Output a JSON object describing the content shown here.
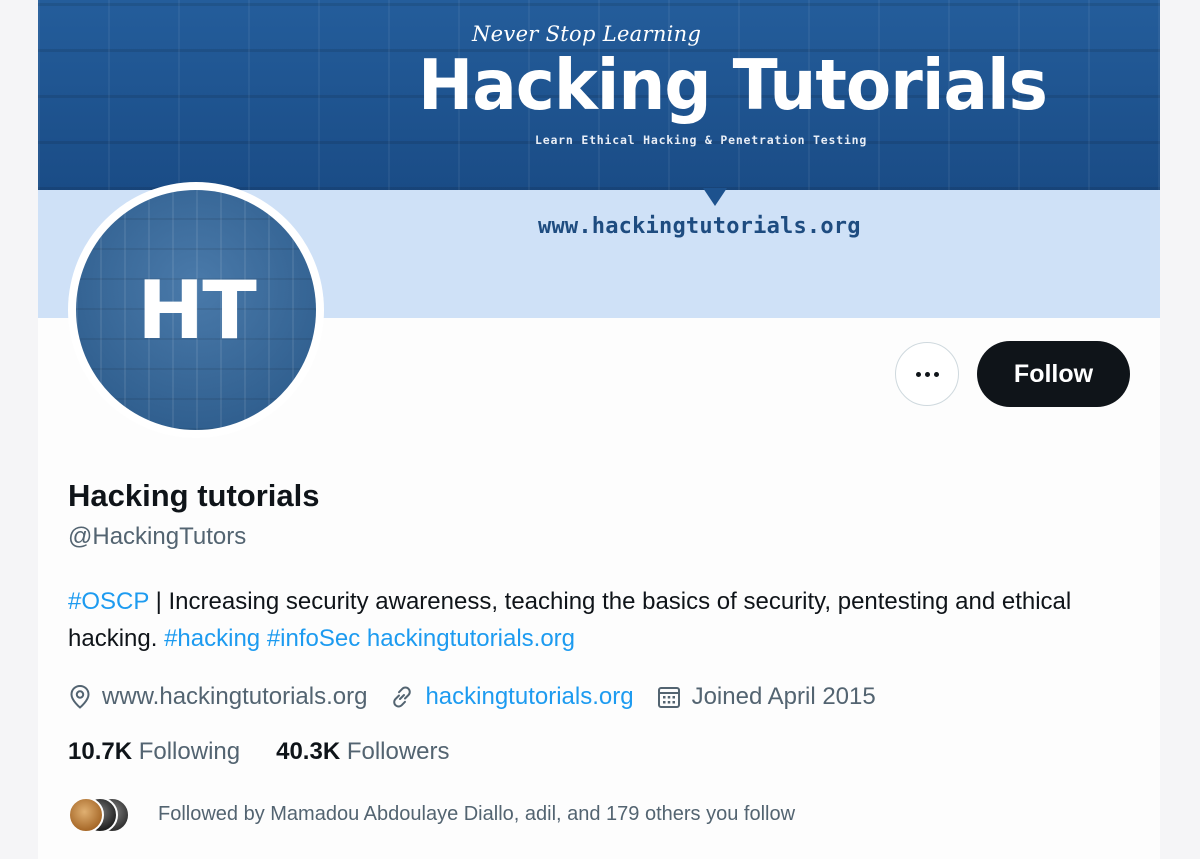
{
  "banner": {
    "slogan": "Never Stop Learning",
    "title": "Hacking Tutorials",
    "subtitle": "Learn Ethical Hacking & Penetration Testing",
    "url": "www.hackingtutorials.org"
  },
  "avatar": {
    "initials": "HT"
  },
  "actions": {
    "more_icon": "more-dots-icon",
    "follow_label": "Follow"
  },
  "profile": {
    "name": "Hacking tutorials",
    "handle": "@HackingTutors",
    "bio": {
      "hashtag_oscp": "#OSCP",
      "text_1": " | Increasing security awareness, teaching the basics of security, pentesting and ethical hacking. ",
      "hashtag_hacking": "#hacking",
      "hashtag_infosec": "#infoSec",
      "link": "hackingtutorials.org"
    },
    "location": "www.hackingtutorials.org",
    "website": "hackingtutorials.org",
    "joined": "Joined April 2015"
  },
  "stats": {
    "following_count": "10.7K",
    "following_label": "Following",
    "followers_count": "40.3K",
    "followers_label": "Followers"
  },
  "followed_by": "Followed by Mamadou Abdoulaye Diallo, adil, and 179 others you follow",
  "colors": {
    "link": "#1d9bf0",
    "follow_button": "#0f1419",
    "banner": "#1f5692",
    "banner_light": "#cfe1f7"
  }
}
